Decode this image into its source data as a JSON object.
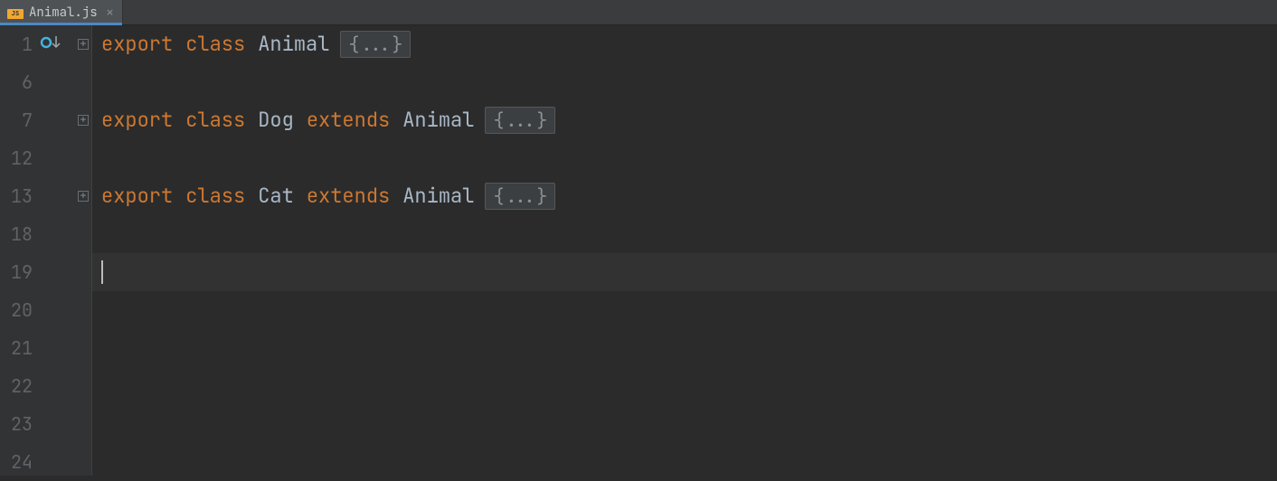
{
  "tabs": [
    {
      "label": "Animal.js",
      "icon_badge": "JS",
      "active": true
    }
  ],
  "editor": {
    "lines": [
      {
        "n": 1,
        "fold": true,
        "marker": "impl",
        "tokens": [
          "kw:export",
          "sp",
          "kw:class",
          "sp",
          "cls:Animal"
        ],
        "folded": "{...}"
      },
      {
        "n": 6
      },
      {
        "n": 7,
        "fold": true,
        "tokens": [
          "kw:export",
          "sp",
          "kw:class",
          "sp",
          "cls:Dog",
          "sp",
          "kw:extends",
          "sp",
          "cls:Animal"
        ],
        "folded": "{...}"
      },
      {
        "n": 12
      },
      {
        "n": 13,
        "fold": true,
        "tokens": [
          "kw:export",
          "sp",
          "kw:class",
          "sp",
          "cls:Cat",
          "sp",
          "kw:extends",
          "sp",
          "cls:Animal"
        ],
        "folded": "{...}"
      },
      {
        "n": 18
      },
      {
        "n": 19,
        "current": true,
        "caret": true
      },
      {
        "n": 20
      },
      {
        "n": 21
      },
      {
        "n": 22
      },
      {
        "n": 23
      },
      {
        "n": 24
      }
    ]
  },
  "tokens_text": {
    "export": "export",
    "class": "class",
    "extends": "extends",
    "Animal": "Animal",
    "Dog": "Dog",
    "Cat": "Cat"
  }
}
